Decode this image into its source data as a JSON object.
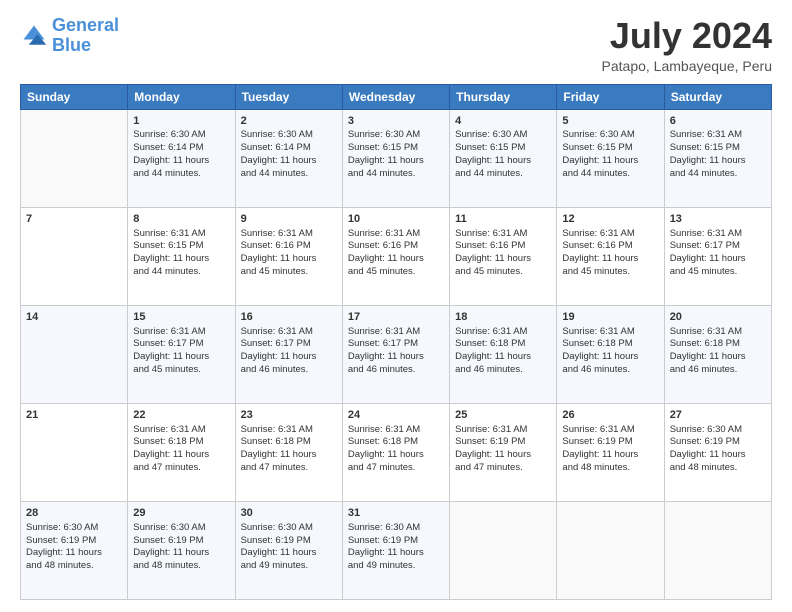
{
  "logo": {
    "line1": "General",
    "line2": "Blue"
  },
  "title": "July 2024",
  "subtitle": "Patapo, Lambayeque, Peru",
  "header_days": [
    "Sunday",
    "Monday",
    "Tuesday",
    "Wednesday",
    "Thursday",
    "Friday",
    "Saturday"
  ],
  "weeks": [
    [
      {
        "day": "",
        "info": ""
      },
      {
        "day": "1",
        "info": "Sunrise: 6:30 AM\nSunset: 6:14 PM\nDaylight: 11 hours\nand 44 minutes."
      },
      {
        "day": "2",
        "info": "Sunrise: 6:30 AM\nSunset: 6:14 PM\nDaylight: 11 hours\nand 44 minutes."
      },
      {
        "day": "3",
        "info": "Sunrise: 6:30 AM\nSunset: 6:15 PM\nDaylight: 11 hours\nand 44 minutes."
      },
      {
        "day": "4",
        "info": "Sunrise: 6:30 AM\nSunset: 6:15 PM\nDaylight: 11 hours\nand 44 minutes."
      },
      {
        "day": "5",
        "info": "Sunrise: 6:30 AM\nSunset: 6:15 PM\nDaylight: 11 hours\nand 44 minutes."
      },
      {
        "day": "6",
        "info": "Sunrise: 6:31 AM\nSunset: 6:15 PM\nDaylight: 11 hours\nand 44 minutes."
      }
    ],
    [
      {
        "day": "7",
        "info": ""
      },
      {
        "day": "8",
        "info": "Sunrise: 6:31 AM\nSunset: 6:15 PM\nDaylight: 11 hours\nand 44 minutes."
      },
      {
        "day": "9",
        "info": "Sunrise: 6:31 AM\nSunset: 6:16 PM\nDaylight: 11 hours\nand 45 minutes."
      },
      {
        "day": "10",
        "info": "Sunrise: 6:31 AM\nSunset: 6:16 PM\nDaylight: 11 hours\nand 45 minutes."
      },
      {
        "day": "11",
        "info": "Sunrise: 6:31 AM\nSunset: 6:16 PM\nDaylight: 11 hours\nand 45 minutes."
      },
      {
        "day": "12",
        "info": "Sunrise: 6:31 AM\nSunset: 6:16 PM\nDaylight: 11 hours\nand 45 minutes."
      },
      {
        "day": "13",
        "info": "Sunrise: 6:31 AM\nSunset: 6:17 PM\nDaylight: 11 hours\nand 45 minutes."
      }
    ],
    [
      {
        "day": "14",
        "info": ""
      },
      {
        "day": "15",
        "info": "Sunrise: 6:31 AM\nSunset: 6:17 PM\nDaylight: 11 hours\nand 45 minutes."
      },
      {
        "day": "16",
        "info": "Sunrise: 6:31 AM\nSunset: 6:17 PM\nDaylight: 11 hours\nand 46 minutes."
      },
      {
        "day": "17",
        "info": "Sunrise: 6:31 AM\nSunset: 6:17 PM\nDaylight: 11 hours\nand 46 minutes."
      },
      {
        "day": "18",
        "info": "Sunrise: 6:31 AM\nSunset: 6:18 PM\nDaylight: 11 hours\nand 46 minutes."
      },
      {
        "day": "19",
        "info": "Sunrise: 6:31 AM\nSunset: 6:18 PM\nDaylight: 11 hours\nand 46 minutes."
      },
      {
        "day": "20",
        "info": "Sunrise: 6:31 AM\nSunset: 6:18 PM\nDaylight: 11 hours\nand 46 minutes."
      }
    ],
    [
      {
        "day": "21",
        "info": ""
      },
      {
        "day": "22",
        "info": "Sunrise: 6:31 AM\nSunset: 6:18 PM\nDaylight: 11 hours\nand 47 minutes."
      },
      {
        "day": "23",
        "info": "Sunrise: 6:31 AM\nSunset: 6:18 PM\nDaylight: 11 hours\nand 47 minutes."
      },
      {
        "day": "24",
        "info": "Sunrise: 6:31 AM\nSunset: 6:18 PM\nDaylight: 11 hours\nand 47 minutes."
      },
      {
        "day": "25",
        "info": "Sunrise: 6:31 AM\nSunset: 6:19 PM\nDaylight: 11 hours\nand 47 minutes."
      },
      {
        "day": "26",
        "info": "Sunrise: 6:31 AM\nSunset: 6:19 PM\nDaylight: 11 hours\nand 48 minutes."
      },
      {
        "day": "27",
        "info": "Sunrise: 6:30 AM\nSunset: 6:19 PM\nDaylight: 11 hours\nand 48 minutes."
      }
    ],
    [
      {
        "day": "28",
        "info": "Sunrise: 6:30 AM\nSunset: 6:19 PM\nDaylight: 11 hours\nand 48 minutes."
      },
      {
        "day": "29",
        "info": "Sunrise: 6:30 AM\nSunset: 6:19 PM\nDaylight: 11 hours\nand 48 minutes."
      },
      {
        "day": "30",
        "info": "Sunrise: 6:30 AM\nSunset: 6:19 PM\nDaylight: 11 hours\nand 49 minutes."
      },
      {
        "day": "31",
        "info": "Sunrise: 6:30 AM\nSunset: 6:19 PM\nDaylight: 11 hours\nand 49 minutes."
      },
      {
        "day": "",
        "info": ""
      },
      {
        "day": "",
        "info": ""
      },
      {
        "day": "",
        "info": ""
      }
    ]
  ]
}
